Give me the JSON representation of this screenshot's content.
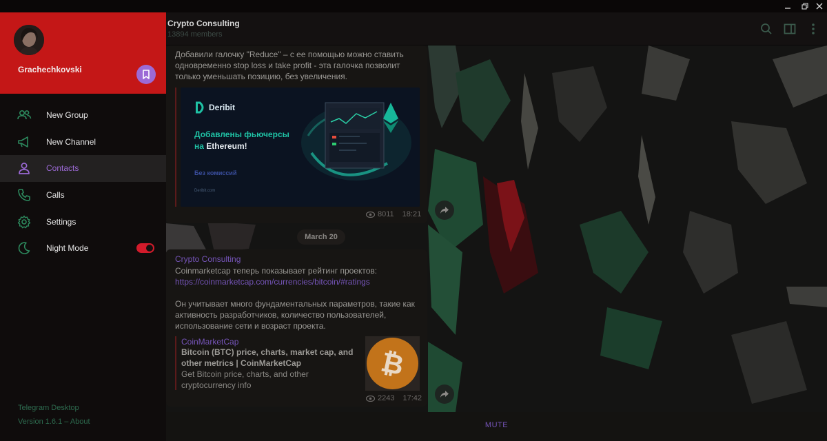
{
  "window": {
    "controls": [
      "minimize",
      "restore",
      "close"
    ]
  },
  "chat": {
    "title": "Crypto Consulting",
    "members": "13894 members",
    "header_icons": [
      "search-icon",
      "sidebar-toggle-icon",
      "more-vertical-icon"
    ]
  },
  "messages": [
    {
      "text_lines": [
        "Добавили галочку \"Reduce\" – с ее помощью можно ставить",
        "одновременно stop loss и take profit - эта галочка позволит",
        "только уменьшать позицию, без увеличения."
      ],
      "banner": {
        "brand": "Deribit",
        "headline_1": "Добавлены фьючерсы",
        "headline_2_prefix": "на ",
        "headline_2_highlight": "Ethereum!",
        "tagline": "Без комиссий",
        "site": "Deribit.com"
      },
      "views": "8011",
      "time": "18:21"
    },
    {
      "sender": "Crypto Consulting",
      "line1": "Coinmarketcap теперь показывает рейтинг проектов:",
      "link": "https://coinmarketcap.com/currencies/bitcoin/#ratings",
      "para_lines": [
        "Он учитывает много фундаментальных параметров, такие как",
        "активность разработчиков, количество пользователей,",
        "использование сети и возраст проекта."
      ],
      "preview": {
        "site_name": "CoinMarketCap",
        "title_lines": [
          "Bitcoin (BTC) price, charts, market cap, and",
          "other metrics | CoinMarketCap"
        ],
        "desc_lines": [
          "Get Bitcoin price, charts, and other",
          "cryptocurrency info"
        ]
      },
      "views": "2243",
      "time": "17:42"
    }
  ],
  "date_divider": "March 20",
  "bottom_bar": {
    "mute_label": "MUTE"
  },
  "sidebar": {
    "username": "Grachechkovski",
    "items": [
      {
        "label": "New Group",
        "icon": "group-icon"
      },
      {
        "label": "New Channel",
        "icon": "megaphone-icon"
      },
      {
        "label": "Contacts",
        "icon": "person-icon",
        "active": true
      },
      {
        "label": "Calls",
        "icon": "phone-icon"
      },
      {
        "label": "Settings",
        "icon": "gear-icon"
      },
      {
        "label": "Night Mode",
        "icon": "moon-icon",
        "toggle_on": true
      }
    ],
    "app_name": "Telegram Desktop",
    "version": "Version 1.6.1 – About"
  },
  "colors": {
    "sidebar_header": "#c41717",
    "accent": "#9c6ad6",
    "icon_green": "#2d8a5e",
    "toggle": "#d21b2b",
    "link": "#7554b8"
  }
}
